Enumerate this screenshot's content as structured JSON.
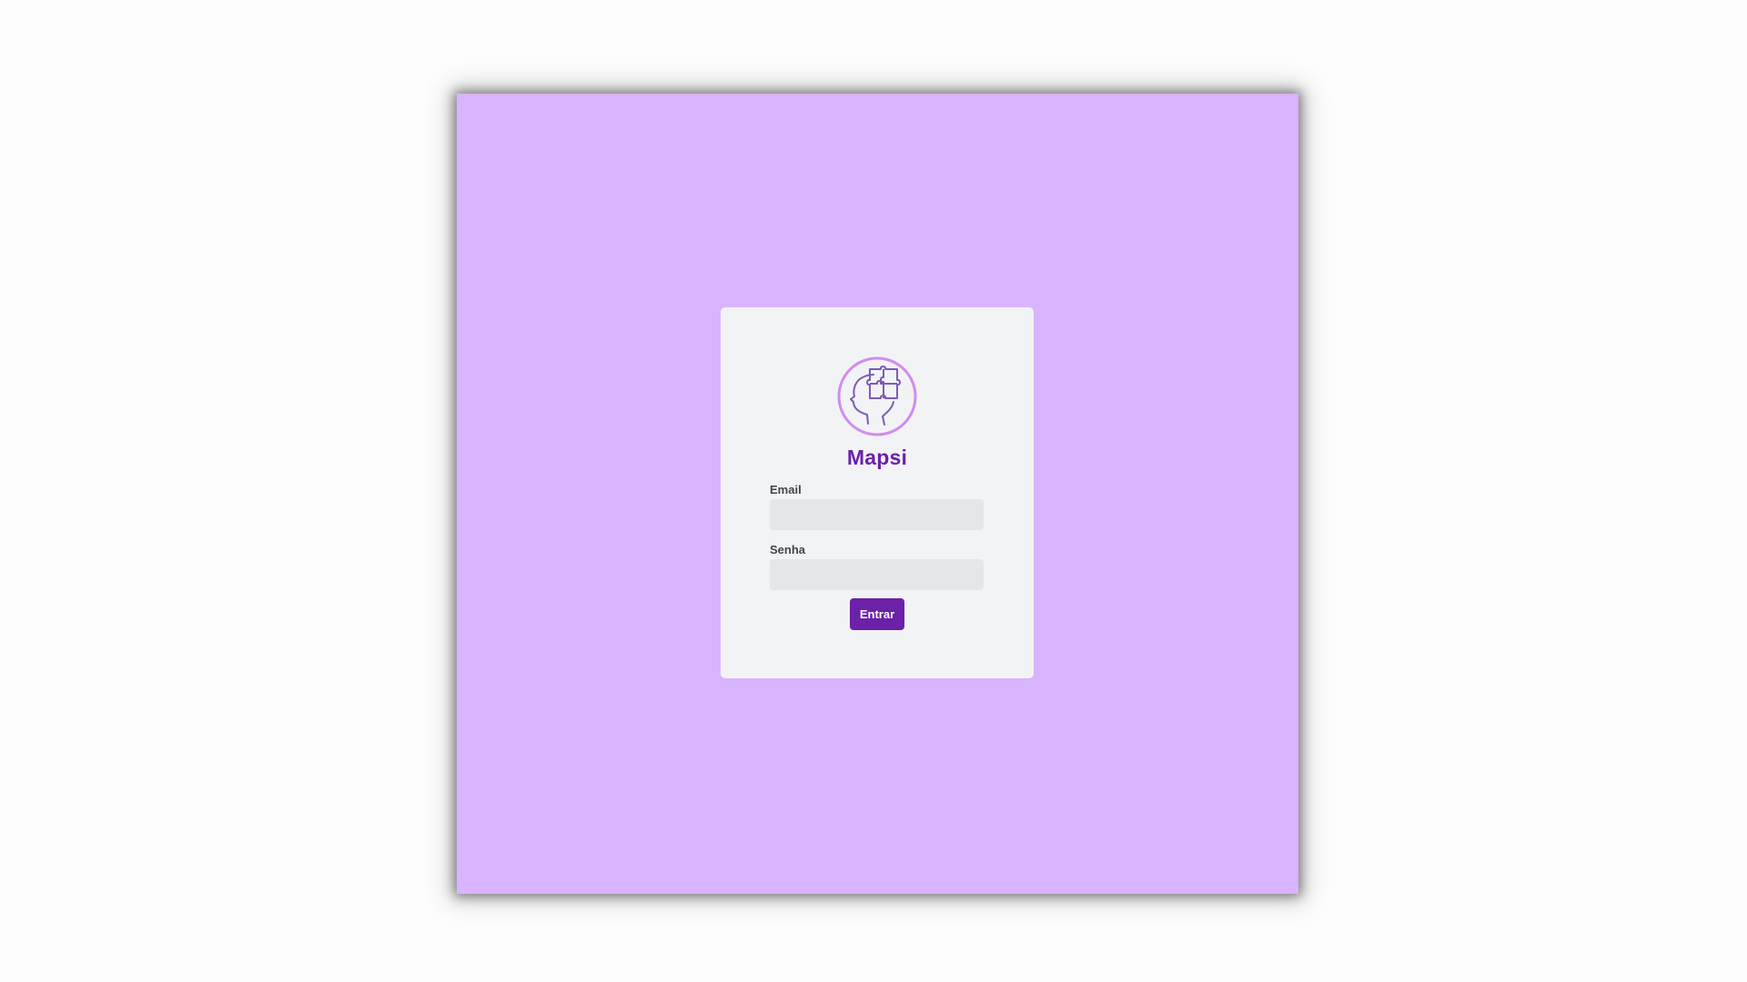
{
  "app": {
    "name": "Mapsi",
    "logo_icon": "head-with-puzzle-icon"
  },
  "form": {
    "email_label": "Email",
    "email_value": "",
    "email_placeholder": "",
    "password_label": "Senha",
    "password_value": "",
    "password_placeholder": "",
    "submit_label": "Entrar"
  },
  "colors": {
    "background": "#d8b4fe",
    "card": "#f2f3f5",
    "brand": "#6b21a8",
    "input": "#e4e6ea",
    "logo_ring": "#d08cf0",
    "logo_stroke": "#7c5bb8"
  }
}
